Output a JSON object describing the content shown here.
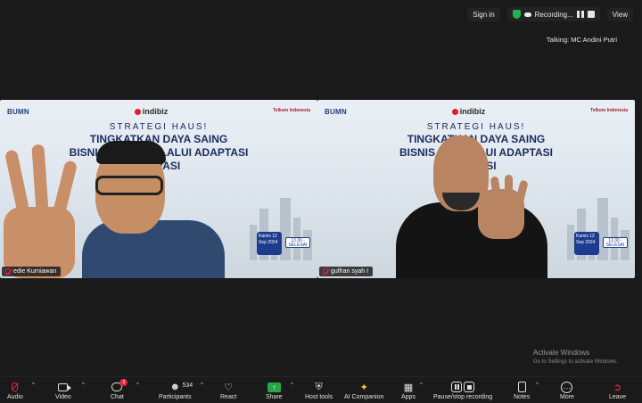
{
  "topbar": {
    "sign_in": "Sign in",
    "recording": "Recording...",
    "view": "View"
  },
  "talking": "Talking: MC Andini Putri",
  "slide": {
    "bumn": "BUMN",
    "brand": "indibiz",
    "telkom": "Telkom Indonesia",
    "line1": "STRATEGI HAUS!",
    "line2_left": "TINGKATKAN DAYA SAING",
    "line3_left": "BISNIS UMKM MELALUI ADAPTASI",
    "line4_left": "INOVASI",
    "line2_right": "TINGKATKAN DAYA SAING",
    "line3_right": "BISNIS U     MELALUI ADAPTASI",
    "line4_right": "NOVASI",
    "date_left": "Kamis 12 Sep 2024",
    "date_right": "Kamis 12 Sep 2024",
    "time": "13.30 - SELESAI"
  },
  "participants": [
    {
      "name": "edie Kurniawan"
    },
    {
      "name": "gulfran syah I"
    }
  ],
  "watermark": {
    "title": "Activate Windows",
    "sub": "Go to Settings to activate Windows."
  },
  "toolbar": {
    "audio": "Audio",
    "video": "Video",
    "chat": "Chat",
    "chat_badge": "2",
    "participants": "Participants",
    "participants_count": "534",
    "react": "React",
    "share": "Share",
    "host_tools": "Host tools",
    "ai_companion": "AI Companion",
    "apps": "Apps",
    "pause_stop": "Pause/stop recording",
    "notes": "Notes",
    "more": "More",
    "leave": "Leave"
  },
  "colors": {
    "accent_green": "#22a84a",
    "alert_red": "#e0263a",
    "slide_navy": "#1b2a5e"
  }
}
